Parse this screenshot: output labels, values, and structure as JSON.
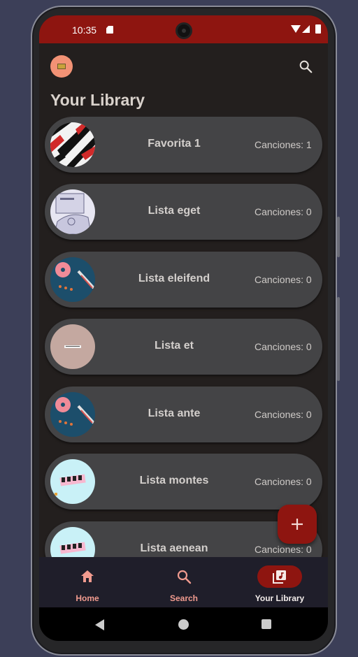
{
  "status_bar": {
    "time": "10:35",
    "icons": [
      "sd-card-icon",
      "wifi-icon",
      "signal-icon",
      "battery-icon"
    ],
    "color": "#8e1510"
  },
  "header": {
    "title": "Your Library",
    "avatar_icon": "avatar-icon",
    "search_icon": "search-icon"
  },
  "playlists": [
    {
      "name": "Favorita 1",
      "count": "Canciones: 1",
      "art": "stripes-art"
    },
    {
      "name": "Lista eget",
      "count": "Canciones: 0",
      "art": "sketch-art"
    },
    {
      "name": "Lista eleifend",
      "count": "Canciones: 0",
      "art": "turntable-art"
    },
    {
      "name": "Lista et",
      "count": "Canciones: 0",
      "art": "beige-art"
    },
    {
      "name": "Lista ante",
      "count": "Canciones: 0",
      "art": "turntable-art"
    },
    {
      "name": "Lista montes",
      "count": "Canciones: 0",
      "art": "pops-art"
    },
    {
      "name": "Lista aenean",
      "count": "Canciones: 0",
      "art": "pops-art"
    }
  ],
  "fab": {
    "icon": "plus-icon"
  },
  "nav": {
    "items": [
      {
        "label": "Home",
        "icon": "home-icon",
        "active": false
      },
      {
        "label": "Search",
        "icon": "search-icon",
        "active": false
      },
      {
        "label": "Your Library",
        "icon": "library-music-icon",
        "active": true
      }
    ],
    "accent": "#f19b8f",
    "active_pill": "#8e1510"
  },
  "system_nav": [
    "back-icon",
    "home-circle-icon",
    "recents-icon"
  ]
}
